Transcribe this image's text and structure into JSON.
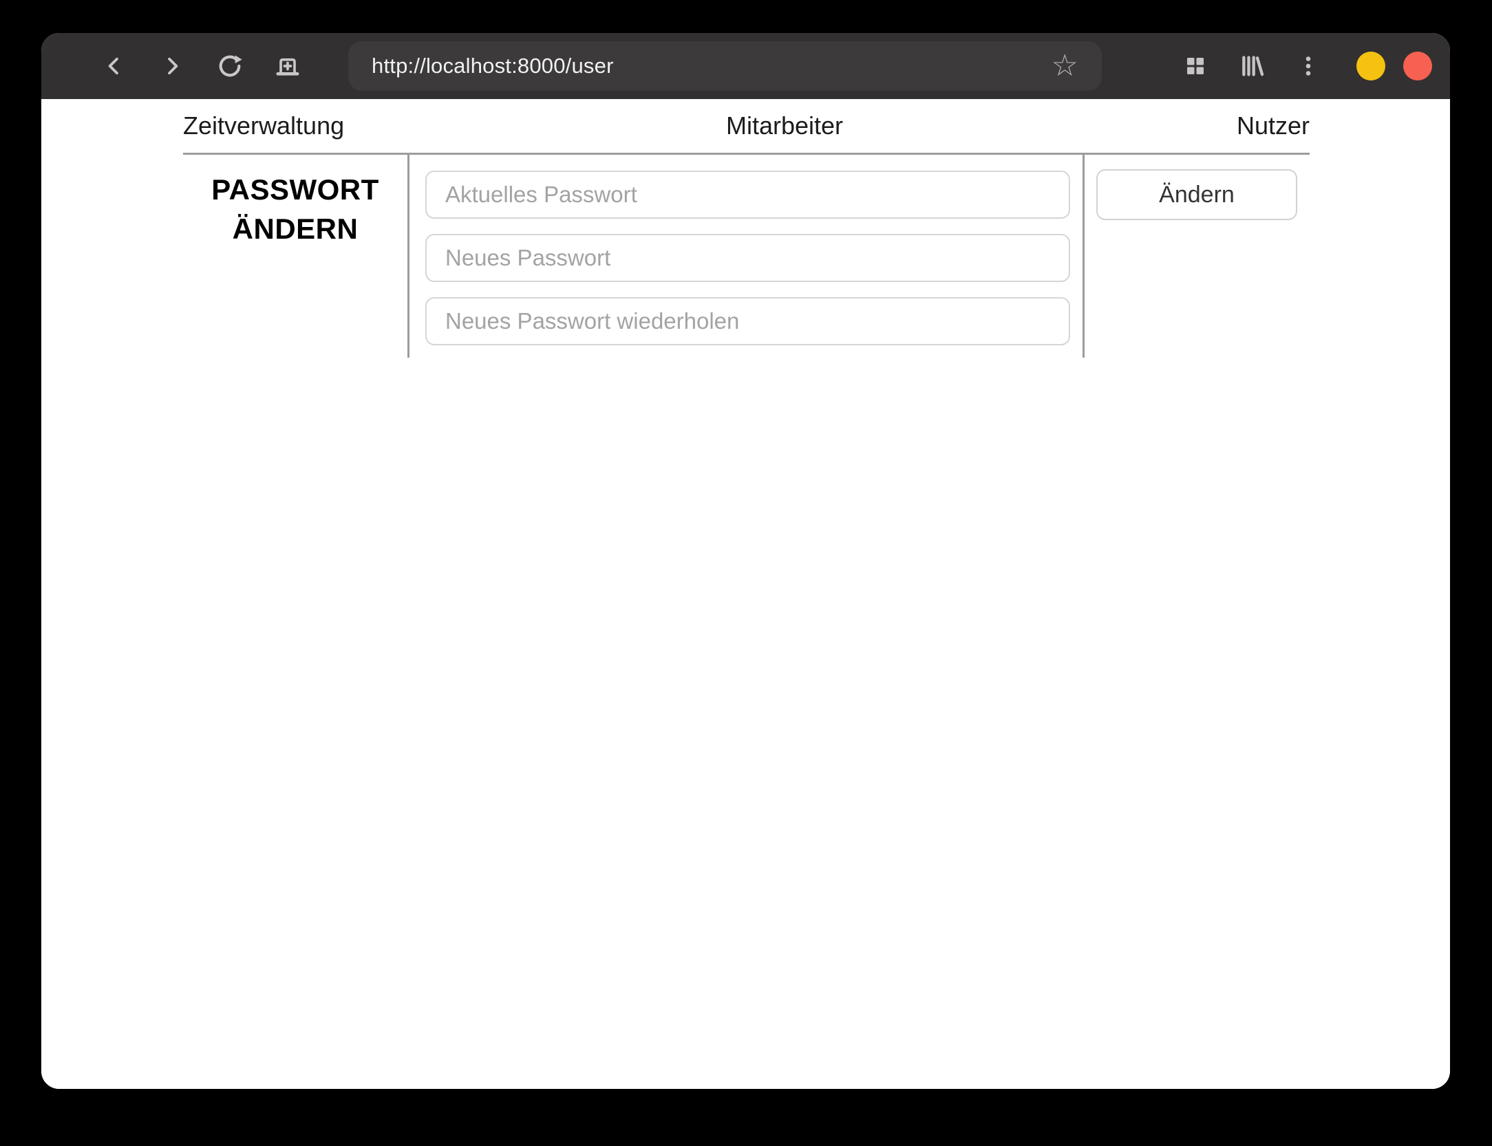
{
  "browser_toolbar": {
    "url": "http://localhost:8000/user",
    "back_icon": "chevron-left",
    "forward_icon": "chevron-right",
    "reload_icon": "reload-arrow",
    "new_tab_icon": "tab-new-plus",
    "bookmark_icon": "star-outline",
    "bookmark_glyph": "☆",
    "tab_overview_icon": "grid-2x2",
    "library_icon": "library-books",
    "menu_icon": "kebab-vertical",
    "minimize_icon": "yellow-circle",
    "close_icon": "red-circle"
  },
  "page": {
    "nav": {
      "items": [
        {
          "label": "Zeitverwaltung"
        },
        {
          "label": "Mitarbeiter"
        },
        {
          "label": "Nutzer"
        }
      ]
    },
    "password_form": {
      "title_line1": "PASSWORT",
      "title_line2": "ÄNDERN",
      "fields": [
        {
          "placeholder": "Aktuelles Passwort",
          "value": ""
        },
        {
          "placeholder": "Neues Passwort",
          "value": ""
        },
        {
          "placeholder": "Neues Passwort wiederholen",
          "value": ""
        }
      ],
      "submit_label": "Ändern"
    }
  },
  "colors": {
    "toolbar_bg": "#333031",
    "urlbar_bg": "#3c3a3a",
    "toolbar_icon": "#c9c7c7",
    "url_text": "#f2f2f2",
    "minimize_button": "#f5c211",
    "close_button": "#f66151",
    "divider": "#9c9c9c",
    "input_border": "#d6d6d6",
    "placeholder": "#a3a3a3",
    "page_text": "#1c1c1c"
  }
}
